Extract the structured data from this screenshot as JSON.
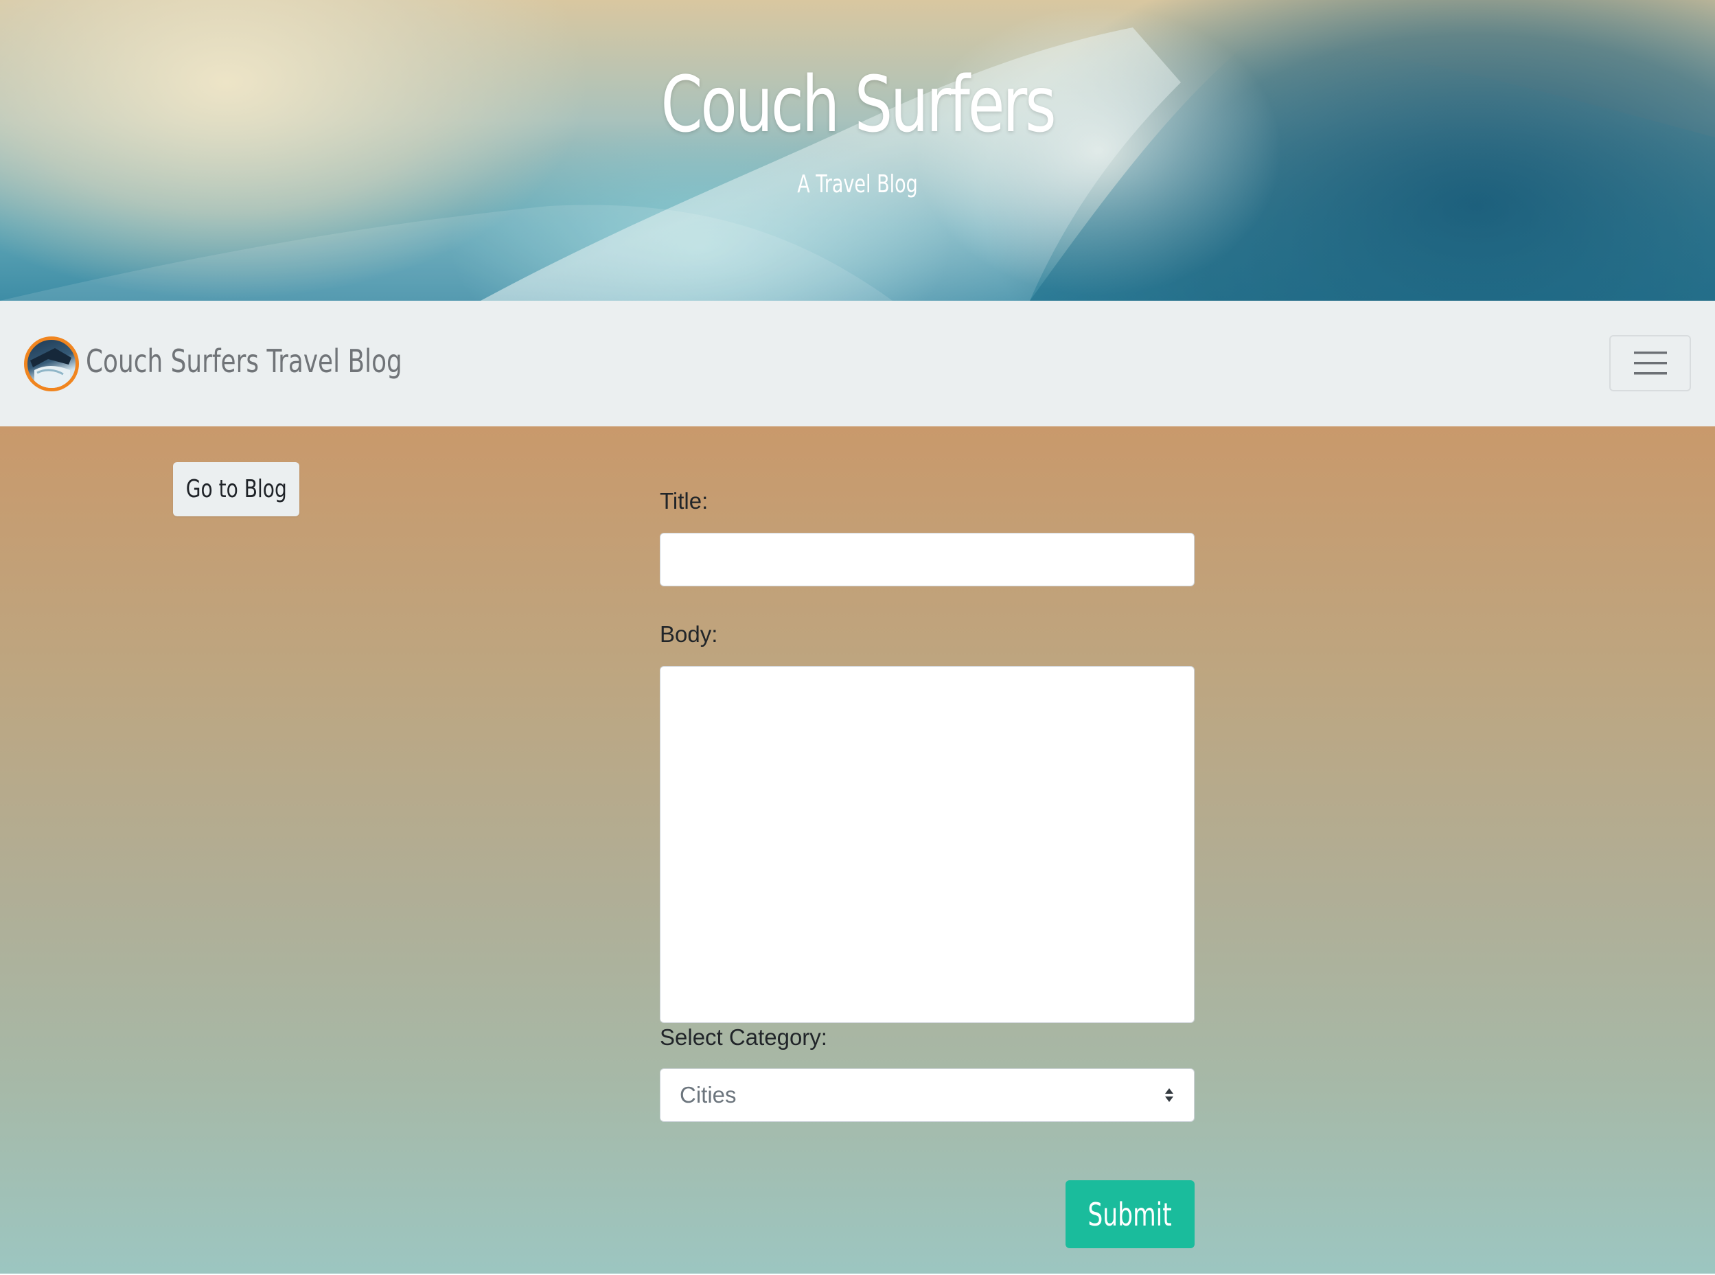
{
  "hero": {
    "title": "Couch Surfers",
    "subtitle": "A Travel Blog"
  },
  "navbar": {
    "brand_text": "Couch Surfers Travel Blog",
    "toggler_icon": "hamburger-menu-icon"
  },
  "main": {
    "go_to_blog_label": "Go to Blog"
  },
  "form": {
    "title_label": "Title:",
    "title_value": "",
    "body_label": "Body:",
    "body_value": "",
    "category_label": "Select Category:",
    "category_value": "Cities",
    "submit_label": "Submit"
  },
  "colors": {
    "navbar_bg": "#ebeff0",
    "submit_bg": "#1abc9c",
    "logo_ring": "#f0851f"
  }
}
